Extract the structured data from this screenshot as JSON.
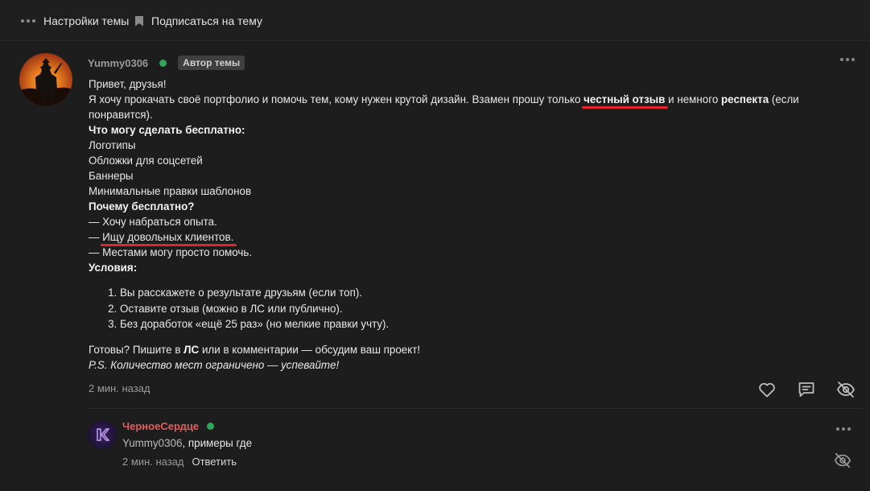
{
  "topbar": {
    "settings_label": "Настройки темы",
    "subscribe_label": "Подписаться на тему"
  },
  "post": {
    "author": "Yummy0306",
    "author_status": "online",
    "badge": "Автор темы",
    "lines": {
      "greeting": "Привет, друзья!",
      "intro_1": "Я хочу прокачать своё портфолио и помочь тем, кому нужен крутой дизайн. Взамен прошу только ",
      "intro_bold_1": "честный отзыв",
      "intro_2": " и немного ",
      "intro_bold_2": "респекта",
      "intro_3": " (если понравится).",
      "free_heading": "Что могу сделать бесплатно:",
      "free_items": [
        "Логотипы",
        "Обложки для соцсетей",
        "Баннеры",
        "Минимальные правки шаблонов"
      ],
      "why_heading": "Почему бесплатно?",
      "why_1": "— Хочу набраться опыта.",
      "why_2_prefix": "— ",
      "why_2_text": "Ищу довольных клиентов.",
      "why_3": "— Местами могу просто помочь.",
      "conditions_heading": "Условия:",
      "conditions": [
        "Вы расскажете о результате друзьям (если топ).",
        "Оставите отзыв (можно в ЛС или публично).",
        "Без доработок «ещё 25 раз» (но мелкие правки учту)."
      ],
      "cta_1": "Готовы? Пишите в ",
      "cta_bold": "ЛС",
      "cta_2": " или в комментарии — обсудим ваш проект!",
      "ps": "P.S. Количество мест ограничено — успевайте!"
    },
    "time": "2 мин. назад",
    "actions": [
      "heart-icon",
      "comment-icon",
      "eye-off-icon"
    ]
  },
  "reply": {
    "author": "ЧерноеСердце",
    "author_status": "online",
    "mention": "Yummy0306",
    "text": ", примеры где",
    "time": "2 мин. назад",
    "reply_label": "Ответить"
  },
  "colors": {
    "background": "#1c1c1c",
    "online": "#2fa55a",
    "underline": "#e2242f",
    "reply_name": "#e35d5d"
  }
}
